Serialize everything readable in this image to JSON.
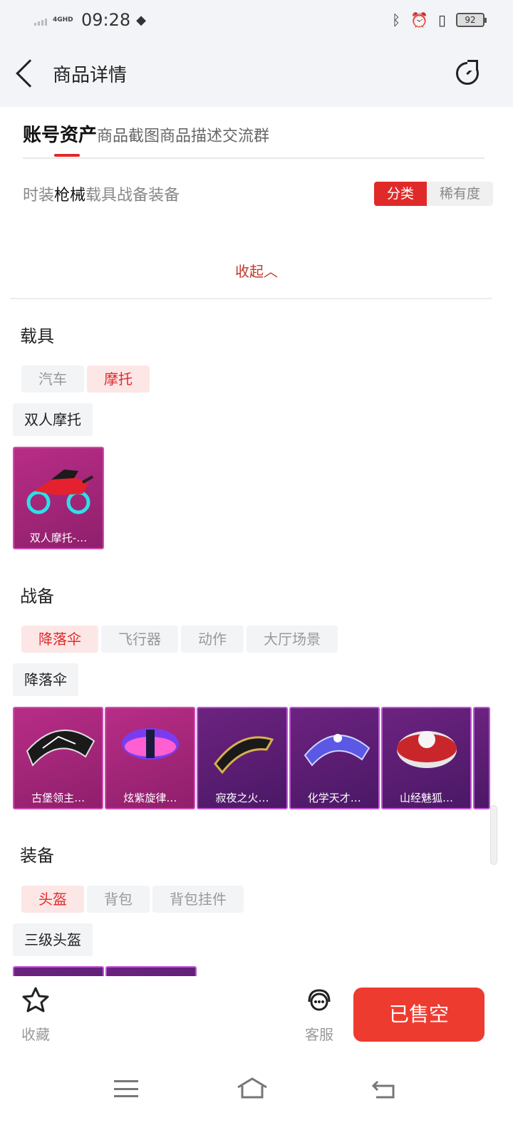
{
  "status_bar": {
    "network": "4GHD",
    "time": "09:28",
    "battery": "92"
  },
  "header": {
    "title": "商品详情"
  },
  "tabs": [
    {
      "label": "账号资产",
      "active": true
    },
    {
      "label": "商品截图"
    },
    {
      "label": "商品描述"
    },
    {
      "label": "交流群"
    }
  ],
  "categories": [
    {
      "label": "时装"
    },
    {
      "label": "枪械",
      "active": true
    },
    {
      "label": "载具"
    },
    {
      "label": "战备"
    },
    {
      "label": "装备"
    }
  ],
  "sort_toggle": {
    "category": "分类",
    "rarity": "稀有度"
  },
  "collapse_label": "收起︿",
  "sections": {
    "vehicle": {
      "title": "载具",
      "chips": [
        "汽车",
        "摩托"
      ],
      "active_chip": "摩托",
      "subcategory": "双人摩托",
      "items": [
        "双人摩托-…"
      ]
    },
    "gear": {
      "title": "战备",
      "chips": [
        "降落伞",
        "飞行器",
        "动作",
        "大厅场景"
      ],
      "active_chip": "降落伞",
      "subcategory": "降落伞",
      "items": [
        "古堡领主…",
        "炫紫旋律…",
        "寂夜之火…",
        "化学天才…",
        "山经魅狐…"
      ]
    },
    "equipment": {
      "title": "装备",
      "chips": [
        "头盔",
        "背包",
        "背包挂件"
      ],
      "active_chip": "头盔",
      "subcategory": "三级头盔"
    }
  },
  "bottom_bar": {
    "favorite": "收藏",
    "service": "客服",
    "sold_out": "已售空"
  },
  "colors": {
    "accent": "#e02a2a",
    "sold_out_button": "#ee3b30",
    "card_pink": "#b82d86",
    "card_purple": "#6c2380"
  },
  "icons": [
    "back-icon",
    "share-icon",
    "star-icon",
    "customer-service-icon",
    "menu-icon",
    "home-icon",
    "return-icon"
  ]
}
